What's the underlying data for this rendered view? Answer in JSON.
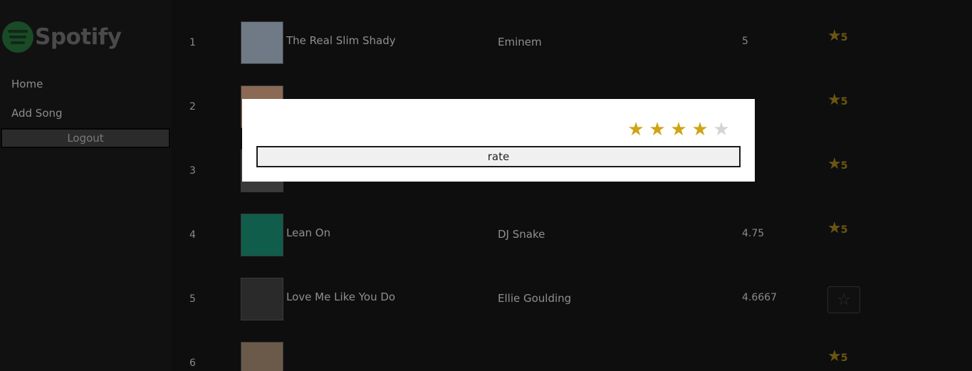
{
  "sidebar": {
    "logo_text": "Spotify",
    "items": [
      {
        "label": "Home"
      },
      {
        "label": "Add Song"
      }
    ],
    "logout_label": "Logout"
  },
  "songs": [
    {
      "rank": "1",
      "title": "The Real Slim Shady",
      "artist": "Eminem",
      "score": "5",
      "user_rating": "5",
      "cover_color": "#6f7a86"
    },
    {
      "rank": "2",
      "title": "",
      "artist": "",
      "score": "",
      "user_rating": "5",
      "cover_color": "#8a6a55"
    },
    {
      "rank": "3",
      "title": "",
      "artist": "",
      "score": "",
      "user_rating": "5",
      "cover_color": "#3a3a3a"
    },
    {
      "rank": "4",
      "title": "Lean On",
      "artist": "DJ Snake",
      "score": "4.75",
      "user_rating": "5",
      "cover_color": "#0f5d4a"
    },
    {
      "rank": "5",
      "title": "Love Me Like You Do",
      "artist": "Ellie Goulding",
      "score": "4.6667",
      "user_rating": "",
      "cover_color": "#2a2a2a"
    },
    {
      "rank": "6",
      "title": "",
      "artist": "",
      "score": "",
      "user_rating": "5",
      "cover_color": "#6b5a4a"
    }
  ],
  "modal": {
    "rating_value": 4,
    "rating_max": 5,
    "submit_label": "rate"
  },
  "colors": {
    "star_active": "#cfa415",
    "star_inactive": "#d4d4d4",
    "spotify_green": "#1db954"
  }
}
